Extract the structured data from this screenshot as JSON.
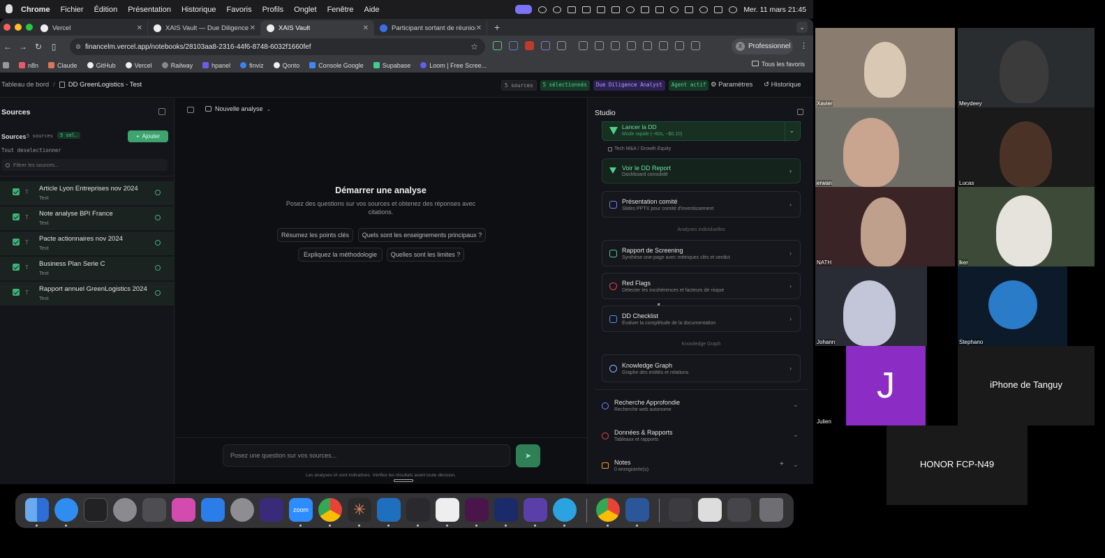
{
  "menubar": {
    "app": "Chrome",
    "items": [
      "Fichier",
      "Édition",
      "Présentation",
      "Historique",
      "Favoris",
      "Profils",
      "Onglet",
      "Fenêtre",
      "Aide"
    ],
    "datetime": "Mer. 11 mars  21:45"
  },
  "browser": {
    "tabs": [
      {
        "label": "Vercel"
      },
      {
        "label": "XAIS Vault — Due Diligence fi"
      },
      {
        "label": "XAIS Vault"
      },
      {
        "label": "Participant sortant de réunion"
      }
    ],
    "new_tab": "+",
    "url": "financelm.vercel.app/notebooks/28103aa8-2316-44f6-8748-6032f1660fef",
    "profile": {
      "initial": "X",
      "label": "Professionnel"
    },
    "bookmarks": [
      "n8n",
      "Claude",
      "GitHub",
      "Vercel",
      "Railway",
      "hpanel",
      "finviz",
      "Qonto",
      "Console Google",
      "Supabase",
      "Loom | Free Scree..."
    ],
    "bookmarks_right": "Tous les favoris"
  },
  "app": {
    "breadcrumb": {
      "root": "Tableau de bord",
      "separator": "/",
      "current": "DD GreenLogistics - Test"
    },
    "badges": [
      "5 sources",
      "5 sélectionnés",
      "Due Diligence Analyst",
      "Agent actif"
    ],
    "settings_label": "Paramètres",
    "history_label": "Historique",
    "sources": {
      "title": "Sources",
      "count_label": "Sources",
      "count_badge": "5 sources",
      "selected_badge": "5 sel.",
      "add_label": "Ajouter",
      "deselect_label": "Tout deselectionner",
      "filter_placeholder": "Filtrer les sources...",
      "items": [
        {
          "title": "Article Lyon Entreprises nov 2024",
          "type": "Text",
          "icon": "T"
        },
        {
          "title": "Note analyse BPI France",
          "type": "Text",
          "icon": "T"
        },
        {
          "title": "Pacte actionnaires nov 2024",
          "type": "Text",
          "icon": "T"
        },
        {
          "title": "Business Plan Serie C",
          "type": "Text",
          "icon": "T"
        },
        {
          "title": "Rapport annuel GreenLogistics 2024",
          "type": "Text",
          "icon": "T"
        }
      ]
    },
    "chat": {
      "new_analysis": "Nouvelle analyse",
      "heading": "Démarrer une analyse",
      "subtitle_line1": "Posez des questions sur vos sources et obtenez des réponses avec",
      "subtitle_line2": "citations.",
      "suggestions": [
        "Résumez les points clés",
        "Quels sont les enseignements principaux ?",
        "Expliquez la méthodologie",
        "Quelles sont les limites ?"
      ],
      "input_placeholder": "Posez une question sur vos sources...",
      "disclaimer": "Les analyses IA sont indicatives. Vérifiez les résultats avant toute décision."
    },
    "studio": {
      "title": "Studio",
      "launch": {
        "title": "Lancer la DD",
        "subtitle": "Mode rapide (~60s, ~$0.10)"
      },
      "tag": "Tech M&A / Growth Equity",
      "cards_top": [
        {
          "title": "Voir le DD Report",
          "subtitle": "Dashboard consolidé"
        },
        {
          "title": "Présentation comité",
          "subtitle": "Slides PPTX pour comité d'investissement"
        }
      ],
      "section_individual": "Analyses individuelles",
      "cards_individual": [
        {
          "title": "Rapport de Screening",
          "subtitle": "Synthèse one-page avec métriques clés et verdict"
        },
        {
          "title": "Red Flags",
          "subtitle": "Détecter les incohérences et facteurs de risque"
        },
        {
          "title": "DD Checklist",
          "subtitle": "Évaluer la complétude de la documentation"
        }
      ],
      "section_kg": "Knowledge Graph",
      "card_kg": {
        "title": "Knowledge Graph",
        "subtitle": "Graphe des entités et relations"
      },
      "accordions": [
        {
          "title": "Recherche Approfondie",
          "subtitle": "Recherche web autonome"
        },
        {
          "title": "Données & Rapports",
          "subtitle": "Tableaux et rapports"
        },
        {
          "title": "Notes",
          "subtitle": "0 enregistrée(s)"
        }
      ]
    }
  },
  "dock": {
    "zoom_label": "zoom"
  },
  "meeting": {
    "participants": [
      "Xavier",
      "Meydeey",
      "erwan",
      "Lucas",
      "NATH",
      "lker",
      "Johann",
      "Stephano",
      "Julien"
    ],
    "avatar_initial": "J",
    "device_tiles": [
      "iPhone de Tanguy",
      "HONOR FCP-N49"
    ]
  }
}
